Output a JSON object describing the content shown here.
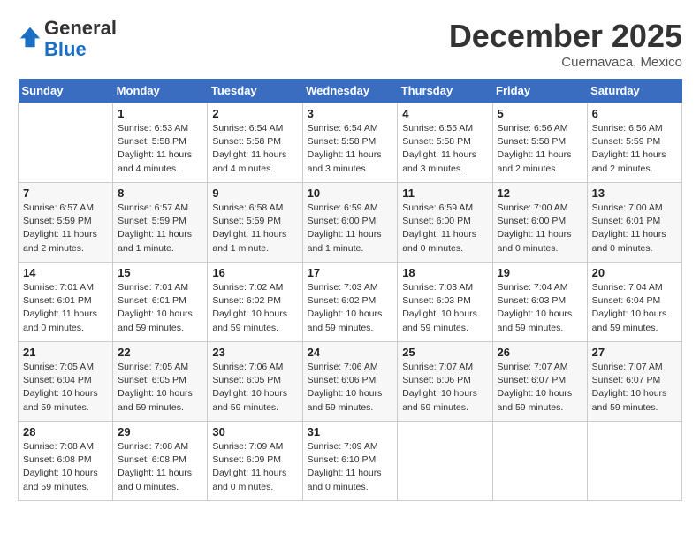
{
  "logo": {
    "line1": "General",
    "line2": "Blue"
  },
  "title": "December 2025",
  "location": "Cuernavaca, Mexico",
  "weekdays": [
    "Sunday",
    "Monday",
    "Tuesday",
    "Wednesday",
    "Thursday",
    "Friday",
    "Saturday"
  ],
  "weeks": [
    [
      {
        "num": "",
        "info": ""
      },
      {
        "num": "1",
        "info": "Sunrise: 6:53 AM\nSunset: 5:58 PM\nDaylight: 11 hours\nand 4 minutes."
      },
      {
        "num": "2",
        "info": "Sunrise: 6:54 AM\nSunset: 5:58 PM\nDaylight: 11 hours\nand 4 minutes."
      },
      {
        "num": "3",
        "info": "Sunrise: 6:54 AM\nSunset: 5:58 PM\nDaylight: 11 hours\nand 3 minutes."
      },
      {
        "num": "4",
        "info": "Sunrise: 6:55 AM\nSunset: 5:58 PM\nDaylight: 11 hours\nand 3 minutes."
      },
      {
        "num": "5",
        "info": "Sunrise: 6:56 AM\nSunset: 5:58 PM\nDaylight: 11 hours\nand 2 minutes."
      },
      {
        "num": "6",
        "info": "Sunrise: 6:56 AM\nSunset: 5:59 PM\nDaylight: 11 hours\nand 2 minutes."
      }
    ],
    [
      {
        "num": "7",
        "info": "Sunrise: 6:57 AM\nSunset: 5:59 PM\nDaylight: 11 hours\nand 2 minutes."
      },
      {
        "num": "8",
        "info": "Sunrise: 6:57 AM\nSunset: 5:59 PM\nDaylight: 11 hours\nand 1 minute."
      },
      {
        "num": "9",
        "info": "Sunrise: 6:58 AM\nSunset: 5:59 PM\nDaylight: 11 hours\nand 1 minute."
      },
      {
        "num": "10",
        "info": "Sunrise: 6:59 AM\nSunset: 6:00 PM\nDaylight: 11 hours\nand 1 minute."
      },
      {
        "num": "11",
        "info": "Sunrise: 6:59 AM\nSunset: 6:00 PM\nDaylight: 11 hours\nand 0 minutes."
      },
      {
        "num": "12",
        "info": "Sunrise: 7:00 AM\nSunset: 6:00 PM\nDaylight: 11 hours\nand 0 minutes."
      },
      {
        "num": "13",
        "info": "Sunrise: 7:00 AM\nSunset: 6:01 PM\nDaylight: 11 hours\nand 0 minutes."
      }
    ],
    [
      {
        "num": "14",
        "info": "Sunrise: 7:01 AM\nSunset: 6:01 PM\nDaylight: 11 hours\nand 0 minutes."
      },
      {
        "num": "15",
        "info": "Sunrise: 7:01 AM\nSunset: 6:01 PM\nDaylight: 10 hours\nand 59 minutes."
      },
      {
        "num": "16",
        "info": "Sunrise: 7:02 AM\nSunset: 6:02 PM\nDaylight: 10 hours\nand 59 minutes."
      },
      {
        "num": "17",
        "info": "Sunrise: 7:03 AM\nSunset: 6:02 PM\nDaylight: 10 hours\nand 59 minutes."
      },
      {
        "num": "18",
        "info": "Sunrise: 7:03 AM\nSunset: 6:03 PM\nDaylight: 10 hours\nand 59 minutes."
      },
      {
        "num": "19",
        "info": "Sunrise: 7:04 AM\nSunset: 6:03 PM\nDaylight: 10 hours\nand 59 minutes."
      },
      {
        "num": "20",
        "info": "Sunrise: 7:04 AM\nSunset: 6:04 PM\nDaylight: 10 hours\nand 59 minutes."
      }
    ],
    [
      {
        "num": "21",
        "info": "Sunrise: 7:05 AM\nSunset: 6:04 PM\nDaylight: 10 hours\nand 59 minutes."
      },
      {
        "num": "22",
        "info": "Sunrise: 7:05 AM\nSunset: 6:05 PM\nDaylight: 10 hours\nand 59 minutes."
      },
      {
        "num": "23",
        "info": "Sunrise: 7:06 AM\nSunset: 6:05 PM\nDaylight: 10 hours\nand 59 minutes."
      },
      {
        "num": "24",
        "info": "Sunrise: 7:06 AM\nSunset: 6:06 PM\nDaylight: 10 hours\nand 59 minutes."
      },
      {
        "num": "25",
        "info": "Sunrise: 7:07 AM\nSunset: 6:06 PM\nDaylight: 10 hours\nand 59 minutes."
      },
      {
        "num": "26",
        "info": "Sunrise: 7:07 AM\nSunset: 6:07 PM\nDaylight: 10 hours\nand 59 minutes."
      },
      {
        "num": "27",
        "info": "Sunrise: 7:07 AM\nSunset: 6:07 PM\nDaylight: 10 hours\nand 59 minutes."
      }
    ],
    [
      {
        "num": "28",
        "info": "Sunrise: 7:08 AM\nSunset: 6:08 PM\nDaylight: 10 hours\nand 59 minutes."
      },
      {
        "num": "29",
        "info": "Sunrise: 7:08 AM\nSunset: 6:08 PM\nDaylight: 11 hours\nand 0 minutes."
      },
      {
        "num": "30",
        "info": "Sunrise: 7:09 AM\nSunset: 6:09 PM\nDaylight: 11 hours\nand 0 minutes."
      },
      {
        "num": "31",
        "info": "Sunrise: 7:09 AM\nSunset: 6:10 PM\nDaylight: 11 hours\nand 0 minutes."
      },
      {
        "num": "",
        "info": ""
      },
      {
        "num": "",
        "info": ""
      },
      {
        "num": "",
        "info": ""
      }
    ]
  ]
}
